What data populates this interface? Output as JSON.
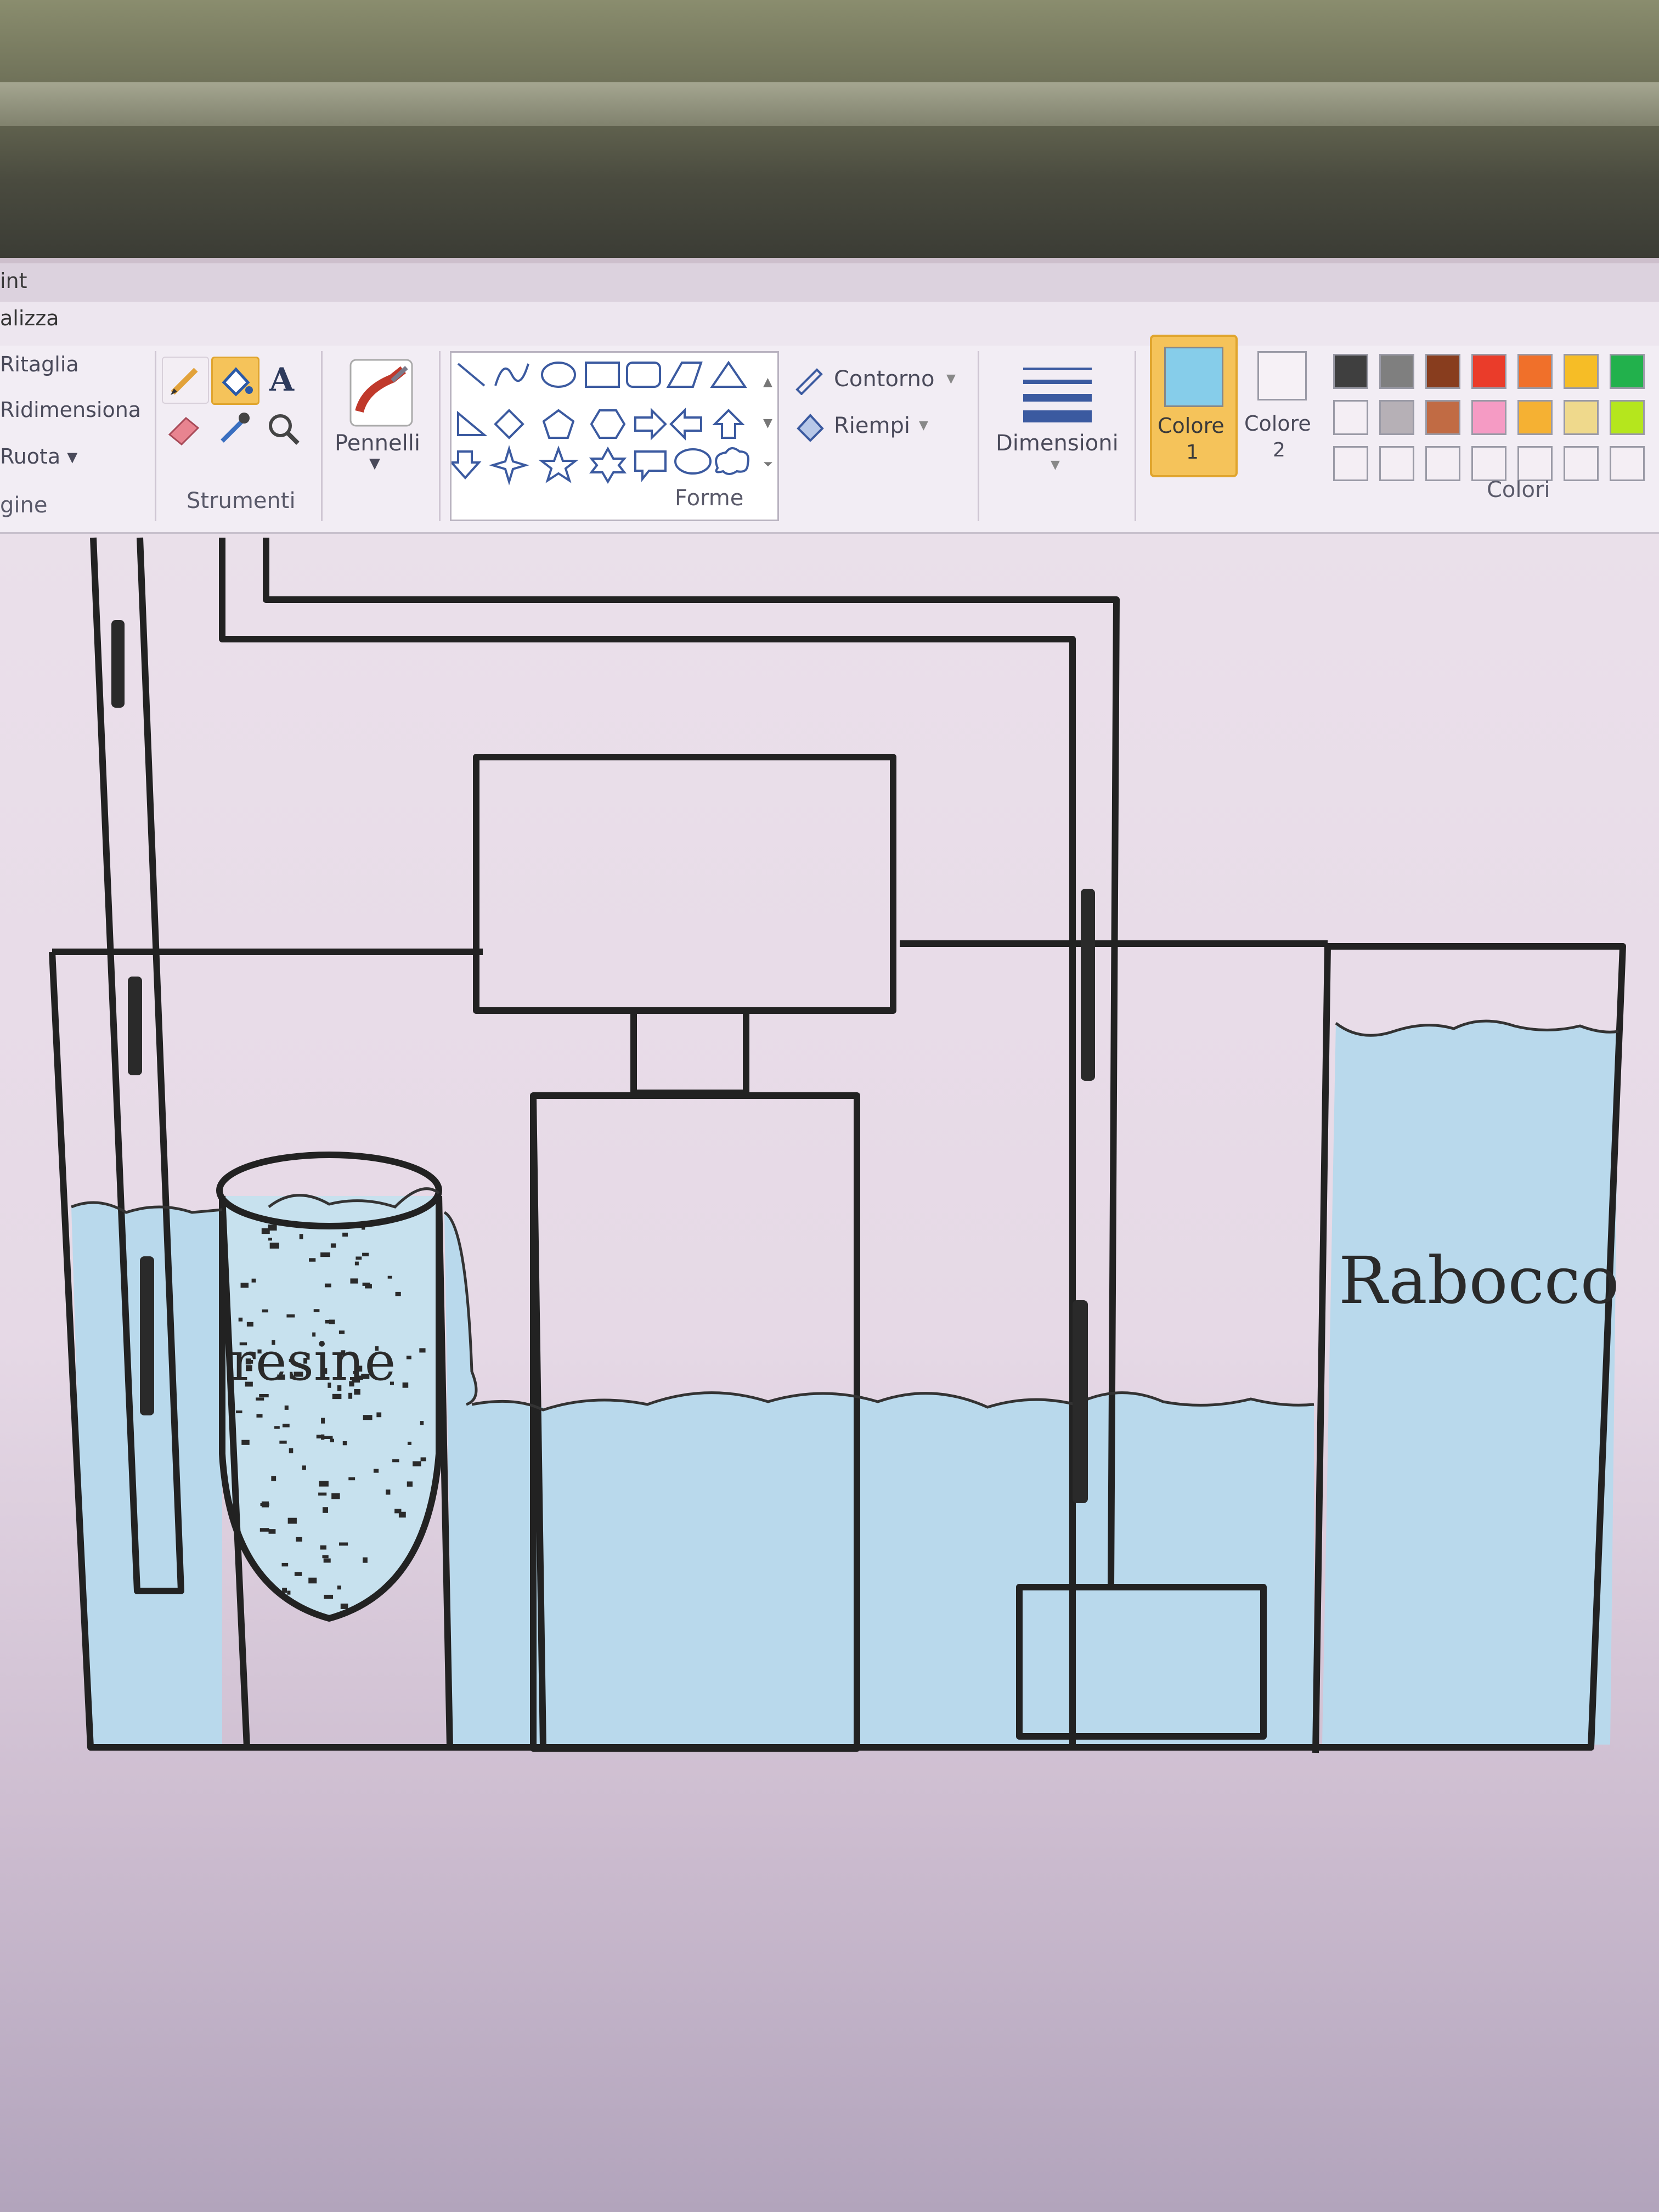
{
  "window": {
    "title_fragment": "int",
    "tab_fragment": "alizza"
  },
  "image_group": {
    "crop_label": "Ritaglia",
    "resize_label": "Ridimensiona",
    "rotate_label": "Ruota",
    "group_label": "gine"
  },
  "tools_group": {
    "label": "Strumenti"
  },
  "brushes": {
    "label": "Pennelli"
  },
  "shapes_group": {
    "label": "Forme",
    "outline_label": "Contorno",
    "fill_label": "Riempi"
  },
  "size": {
    "label": "Dimensioni"
  },
  "color1": {
    "label": "Colore",
    "number": "1",
    "value": "#86cdea"
  },
  "color2": {
    "label": "Colore",
    "number": "2"
  },
  "colors_group": {
    "label": "Colori",
    "palette_row1": [
      "#3f3f3f",
      "#7f7f7f",
      "#883d1e",
      "#ea3c2a",
      "#f0702a",
      "#f6bd26",
      "#22b14c"
    ],
    "palette_row2": [
      "#f4eef4",
      "#b6b0b6",
      "#c16b44",
      "#f59bc4",
      "#f5b133",
      "#efd98c",
      "#b5e61d"
    ]
  },
  "drawing": {
    "resin_label": "resine",
    "topup_label": "Rabocco",
    "water_color": "#b9d9ec"
  }
}
